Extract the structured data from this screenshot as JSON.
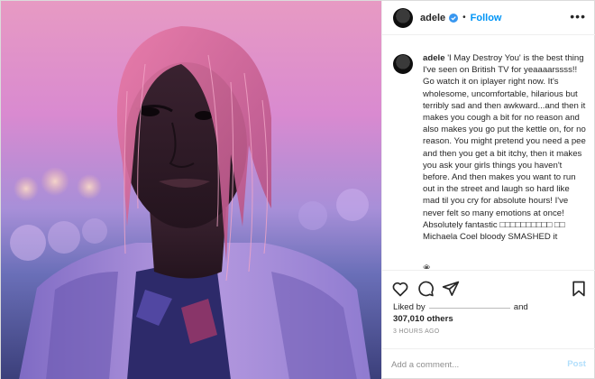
{
  "header": {
    "username": "adele",
    "separator": "•",
    "follow_label": "Follow",
    "more_label": "•••"
  },
  "caption": {
    "username": "adele",
    "text": "'I May Destroy You' is the best thing I've seen on British TV for yeaaaarssss!! Go watch it on iplayer right now. It's wholesome, uncomfortable, hilarious but terribly sad and then awkward...and then it makes you cough a bit for no reason and also makes you go put the kettle on, for no reason. You might pretend you need a pee and then you get a bit itchy, then it makes you ask your girls things you haven't before. And then makes you want to run out in the street and laugh so hard like mad til you cry for absolute hours! I've never felt so many emotions at once! Absolutely fantastic □□□□□□□□□□ □□ Michaela Coel bloody SMASHED it",
    "trailing_icon": "❀"
  },
  "likes": {
    "prefix": "Liked by",
    "conjunction": "and",
    "count": "307,010 others"
  },
  "timestamp": "3 HOURS AGO",
  "comment": {
    "placeholder": "Add a comment...",
    "post_label": "Post"
  },
  "colors": {
    "accent": "#0095f6",
    "post_disabled": "#b2dffc",
    "muted": "#8e8e8e"
  },
  "icons": [
    "verified-badge-icon",
    "heart-icon",
    "comment-icon",
    "share-icon",
    "bookmark-icon",
    "more-options-icon"
  ]
}
